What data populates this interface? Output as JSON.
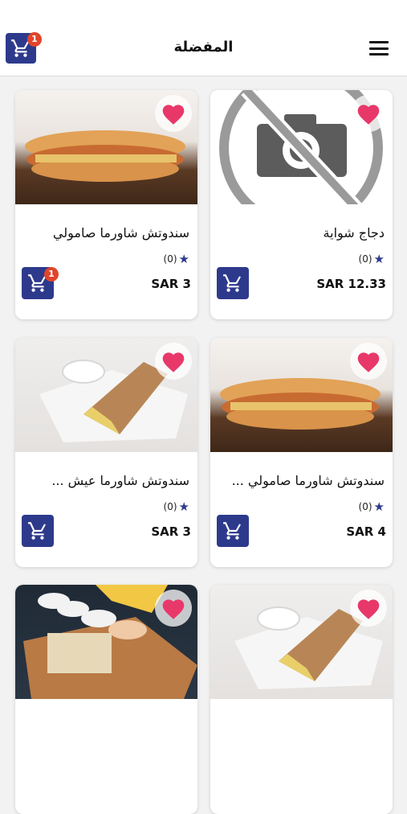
{
  "header": {
    "title": "المفضلة",
    "cart_count": "1",
    "cart_icon": "cart-icon",
    "menu_icon": "menu-icon"
  },
  "colors": {
    "accent": "#2d3a8c",
    "badge": "#e0452b",
    "heart": "#e8386a"
  },
  "products": [
    {
      "name": "دجاج شواية",
      "rating": "(0)",
      "price": "SAR 12.33",
      "image": "no-photo",
      "cart_badge": ""
    },
    {
      "name": "سندوتش شاورما صامولي",
      "rating": "(0)",
      "price": "SAR 3",
      "image": "sandwich",
      "cart_badge": "1"
    },
    {
      "name": "سندوتش شاورما صامولي ...",
      "rating": "(0)",
      "price": "SAR 4",
      "image": "sandwich",
      "cart_badge": ""
    },
    {
      "name": "سندوتش شاورما عيش ...",
      "rating": "(0)",
      "price": "SAR 3",
      "image": "wrap",
      "cart_badge": ""
    },
    {
      "name": "",
      "rating": "",
      "price": "",
      "image": "wrap",
      "cart_badge": ""
    },
    {
      "name": "",
      "rating": "",
      "price": "",
      "image": "platter",
      "cart_badge": ""
    }
  ]
}
